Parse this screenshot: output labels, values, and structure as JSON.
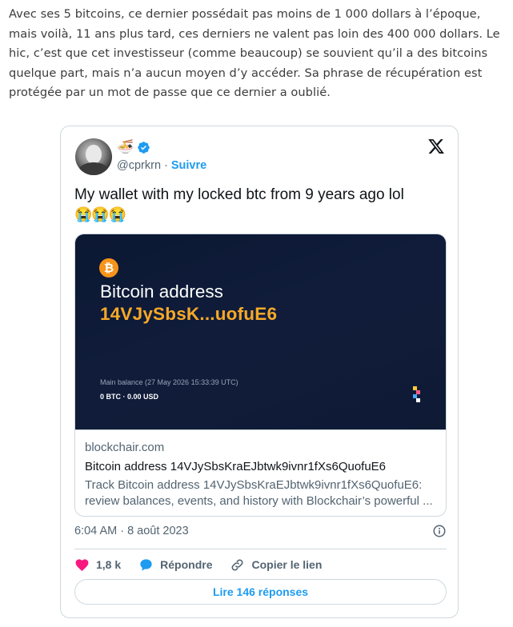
{
  "article": {
    "paragraph": "Avec ses 5 bitcoins, ce dernier possédait pas moins de 1 000 dollars à l’époque, mais voilà, 11 ans plus tard, ces derniers ne valent pas loin des 400 000 dollars. Le hic, c’est que cet investisseur (comme beaucoup) se souvient qu’il a des bitcoins quelque part, mais n’a aucun moyen d’y accéder. Sa phrase de récupération est protégée par un mot de passe que ce dernier a oublié."
  },
  "tweet": {
    "name_emoji": "🍜",
    "handle": "@cprkrn",
    "separator": "·",
    "follow_label": "Suivre",
    "text": "My wallet with my locked btc from 9 years ago lol",
    "emojis": "😭😭😭",
    "preview": {
      "btc_symbol": "₿",
      "title": "Bitcoin address",
      "address_short": "14VJySbsK...uofuE6",
      "balance_label": "Main balance (27 May 2026 15:33:39 UTC)",
      "balance_value": "0 BTC · 0.00 USD",
      "domain": "blockchair.com",
      "link_title": "Bitcoin address 14VJySbsKraEJbtwk9ivnr1fXs6QuofuE6",
      "link_desc": "Track Bitcoin address 14VJySbsKraEJbtwk9ivnr1fXs6QuofuE6: review balances, events, and history with Blockchair’s powerful ..."
    },
    "timestamp": "6:04 AM · 8 août 2023",
    "actions": {
      "likes": "1,8 k",
      "reply_label": "Répondre",
      "copy_label": "Copier le lien"
    },
    "replies_button": "Lire 146 réponses"
  },
  "colors": {
    "accent": "#1d9bf0",
    "like": "#f91880",
    "bitcoin": "#f7931a",
    "address": "#f7a928",
    "preview_bg": "#0f1b35"
  },
  "icons": [
    "avatar",
    "noodle-emoji",
    "verified-badge-icon",
    "x-logo-icon",
    "bitcoin-icon",
    "blockchair-logo-icon",
    "info-icon",
    "heart-icon",
    "reply-bubble-icon",
    "link-icon"
  ]
}
